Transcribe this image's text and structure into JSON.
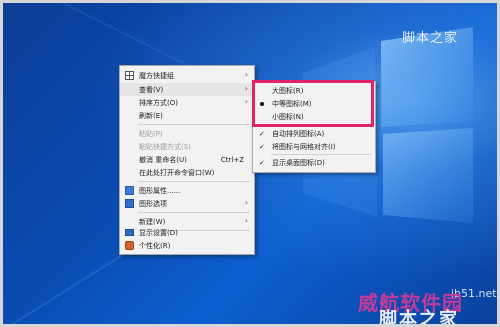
{
  "context_menu": {
    "items": [
      {
        "label": "魔方快捷组",
        "has_arrow": true,
        "icon": "grid-icon"
      },
      {
        "label": "查看(V)",
        "has_arrow": true,
        "highlighted": true
      },
      {
        "label": "排序方式(O)",
        "has_arrow": true
      },
      {
        "label": "刷新(E)"
      },
      {
        "label": "粘贴(P)",
        "disabled": true
      },
      {
        "label": "粘贴快捷方式(S)",
        "disabled": true
      },
      {
        "label": "撤消 重命名(U)",
        "shortcut": "Ctrl+Z"
      },
      {
        "label": "在此处打开命令窗口(W)"
      },
      {
        "label": "图形属性......",
        "icon": "display-settings-icon"
      },
      {
        "label": "图形选项",
        "has_arrow": true,
        "icon": "graphics-options-icon"
      },
      {
        "label": "新建(W)",
        "has_arrow": true
      },
      {
        "label": "显示设置(D)",
        "icon": "monitor-icon"
      },
      {
        "label": "个性化(R)",
        "icon": "personalize-icon"
      }
    ]
  },
  "view_submenu": {
    "items": [
      {
        "label": "大图标(R)"
      },
      {
        "label": "中等图标(M)",
        "selected": true
      },
      {
        "label": "小图标(N)"
      },
      {
        "label": "自动排列图标(A)",
        "checked": true
      },
      {
        "label": "将图标与网格对齐(I)",
        "checked": true
      },
      {
        "label": "显示桌面图标(D)",
        "checked": true
      }
    ]
  },
  "watermarks": {
    "top": "脚本之家",
    "url": "jb51.net",
    "bottom_main": "威航软件园",
    "bottom_sub": "脚本之家"
  },
  "colors": {
    "highlight_box": "#e0236a",
    "desktop_blue": "#0b4db3"
  }
}
